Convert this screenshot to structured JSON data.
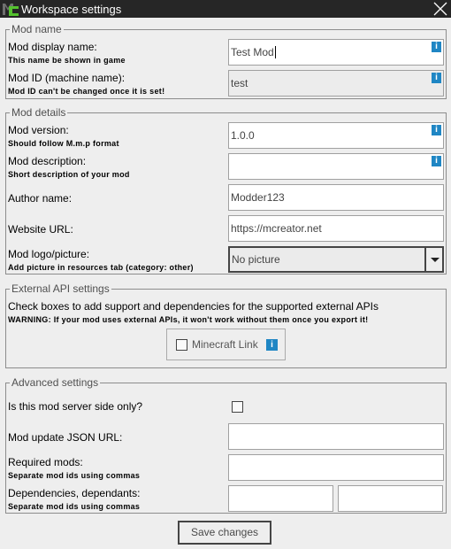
{
  "window": {
    "title": "Workspace settings",
    "logo_icon": "mcreator-logo-icon",
    "close_icon": "close-icon"
  },
  "mod_name": {
    "legend": "Mod name",
    "display_name": {
      "label": "Mod display name:",
      "hint": "This name be shown in game",
      "value": "Test Mod",
      "info": "i"
    },
    "mod_id": {
      "label": "Mod ID (machine name):",
      "hint": "Mod ID can't be changed once it is set!",
      "value": "test",
      "info": "i"
    }
  },
  "mod_details": {
    "legend": "Mod details",
    "version": {
      "label": "Mod version:",
      "hint": "Should follow M.m.p format",
      "value": "1.0.0",
      "info": "i"
    },
    "description": {
      "label": "Mod description:",
      "hint": "Short description of your mod",
      "value": "",
      "info": "i"
    },
    "author": {
      "label": "Author name:",
      "value": "Modder123"
    },
    "website": {
      "label": "Website URL:",
      "value": "https://mcreator.net"
    },
    "logo": {
      "label": "Mod logo/picture:",
      "hint": "Add picture in resources tab (category: other)",
      "selected": "No picture"
    }
  },
  "external_api": {
    "legend": "External API settings",
    "description": "Check boxes to add support and dependencies for the supported external APIs",
    "warning": "WARNING: If your mod uses external APIs, it won't work without them once you export it!",
    "apis": [
      {
        "label": "Minecraft Link",
        "checked": false,
        "info": "i"
      }
    ]
  },
  "advanced": {
    "legend": "Advanced settings",
    "server_side": {
      "label": "Is this mod server side only?",
      "checked": false
    },
    "update_url": {
      "label": "Mod update JSON URL:",
      "value": ""
    },
    "required_mods": {
      "label": "Required mods:",
      "hint": "Separate mod ids using commas",
      "value": ""
    },
    "dependencies": {
      "label": "Dependencies, dependants:",
      "hint": "Separate mod ids using commas",
      "dependencies_value": "",
      "dependants_value": ""
    }
  },
  "footer": {
    "save_label": "Save changes"
  }
}
